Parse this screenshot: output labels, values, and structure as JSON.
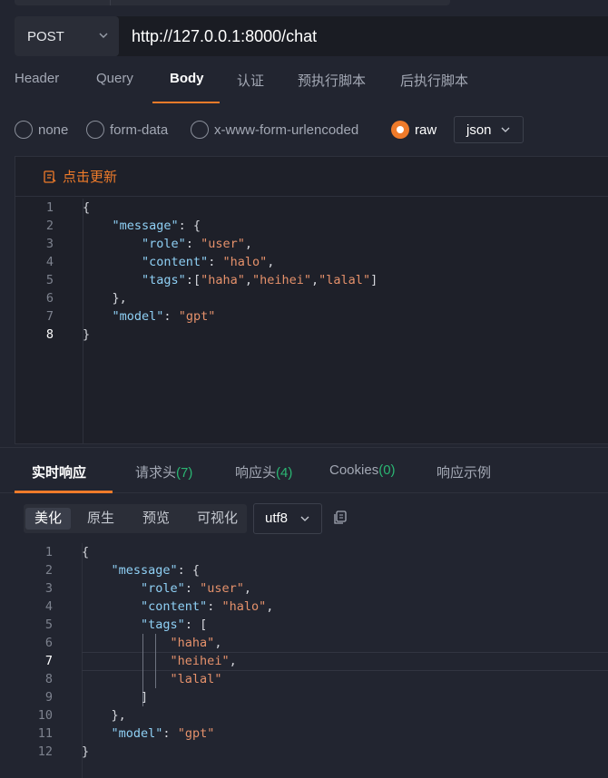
{
  "request": {
    "method": "POST",
    "url": "http://127.0.0.1:8000/chat"
  },
  "tabs": [
    {
      "label": "Header"
    },
    {
      "label": "Query"
    },
    {
      "label": "Body",
      "active": true
    },
    {
      "label": "认证"
    },
    {
      "label": "预执行脚本"
    },
    {
      "label": "后执行脚本"
    }
  ],
  "body_types": [
    {
      "label": "none"
    },
    {
      "label": "form-data"
    },
    {
      "label": "x-www-form-urlencoded"
    },
    {
      "label": "raw",
      "checked": true
    }
  ],
  "body_format": "json",
  "editor": {
    "update_label": "点击更新",
    "lines": [
      "1",
      "2",
      "3",
      "4",
      "5",
      "6",
      "7",
      "8"
    ]
  },
  "response_tabs": [
    {
      "label": "实时响应",
      "active": true
    },
    {
      "label": "请求头",
      "count": "(7)"
    },
    {
      "label": "响应头",
      "count": "(4)"
    },
    {
      "label": "Cookies",
      "count": "(0)"
    },
    {
      "label": "响应示例"
    }
  ],
  "view_modes": [
    {
      "label": "美化",
      "active": true
    },
    {
      "label": "原生"
    },
    {
      "label": "预览"
    },
    {
      "label": "可视化"
    }
  ],
  "encoding": "utf8",
  "response": {
    "lines": [
      "1",
      "2",
      "3",
      "4",
      "5",
      "6",
      "7",
      "8",
      "9",
      "10",
      "11",
      "12"
    ]
  },
  "icons": {
    "method_dropdown": "chevron-down-icon",
    "format_dropdown": "chevron-down-icon",
    "update": "refresh-icon",
    "copy": "copy-icon"
  },
  "colors": {
    "accent": "#ef7b2a",
    "count": "#2bb673",
    "json_key": "#8fd0f5",
    "json_string": "#e5916b"
  }
}
